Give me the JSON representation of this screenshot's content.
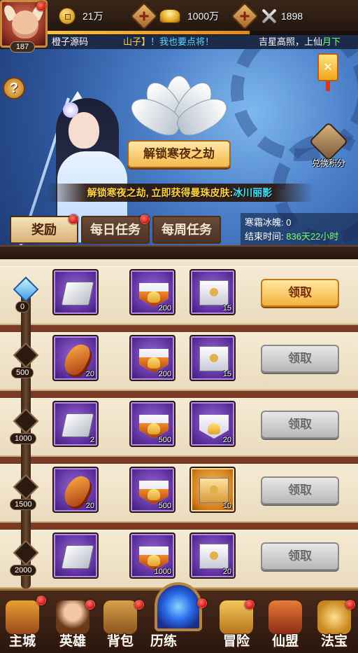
{
  "player": {
    "level": "187",
    "name": "橙子源码"
  },
  "resources": {
    "copper": "21万",
    "gold": "1000万",
    "power": "1898"
  },
  "marquee": {
    "part1": "山子】",
    "part2": "！我也要点将！",
    "part3": "吉星高照，上仙",
    "part4": "月下"
  },
  "exp_progress": 0.65,
  "banner": {
    "unlock_button": "解锁寒夜之劫",
    "promo_text": "解锁寒夜之劫, 立即获得曼珠皮肤:",
    "promo_skin": "冰川丽影",
    "exchange_label": "兑换积分"
  },
  "tabs": [
    {
      "label": "奖励",
      "active": true
    },
    {
      "label": "每日任务",
      "active": false
    },
    {
      "label": "每周任务",
      "active": false
    }
  ],
  "event_info": {
    "currency_label": "寒霜冰魄:",
    "currency_value": "0",
    "end_label": "结束时间:",
    "end_value": "836天22小时"
  },
  "rewards": [
    {
      "milestone": "0",
      "claim": "领取",
      "claimable": true,
      "items": [
        {
          "icon": "silver-ingot",
          "count": ""
        },
        {
          "icon": "gold-pouch",
          "count": "200"
        },
        {
          "icon": "envelope",
          "count": "15"
        }
      ]
    },
    {
      "milestone": "500",
      "claim": "领取",
      "claimable": false,
      "items": [
        {
          "icon": "horn",
          "count": "20"
        },
        {
          "icon": "gold-pouch",
          "count": "200"
        },
        {
          "icon": "envelope",
          "count": "15"
        }
      ]
    },
    {
      "milestone": "1000",
      "claim": "领取",
      "claimable": false,
      "items": [
        {
          "icon": "silver-ingot",
          "count": "2"
        },
        {
          "icon": "gold-pouch",
          "count": "500"
        },
        {
          "icon": "envelope",
          "count": "20"
        }
      ]
    },
    {
      "milestone": "1500",
      "claim": "领取",
      "claimable": false,
      "items": [
        {
          "icon": "horn",
          "count": "20"
        },
        {
          "icon": "gold-pouch",
          "count": "500"
        },
        {
          "icon": "gold-envelope",
          "count": "10"
        }
      ]
    },
    {
      "milestone": "2000",
      "claim": "领取",
      "claimable": false,
      "items": [
        {
          "icon": "silver-ingot",
          "count": ""
        },
        {
          "icon": "gold-pouch",
          "count": "1000"
        },
        {
          "icon": "envelope",
          "count": "20"
        }
      ]
    }
  ],
  "nav": [
    {
      "label": "主城",
      "badge": true
    },
    {
      "label": "英雄",
      "badge": true
    },
    {
      "label": "背包",
      "badge": true
    },
    {
      "label": "历练",
      "badge": true
    },
    {
      "label": "冒险",
      "badge": true
    },
    {
      "label": "仙盟",
      "badge": false
    },
    {
      "label": "法宝",
      "badge": true
    }
  ],
  "colors": {
    "accent_gold": "#f4b23c",
    "item_purple": "#5a2e9a",
    "highlight_cyan": "#3ee2ff",
    "time_green": "#7dff6a"
  }
}
